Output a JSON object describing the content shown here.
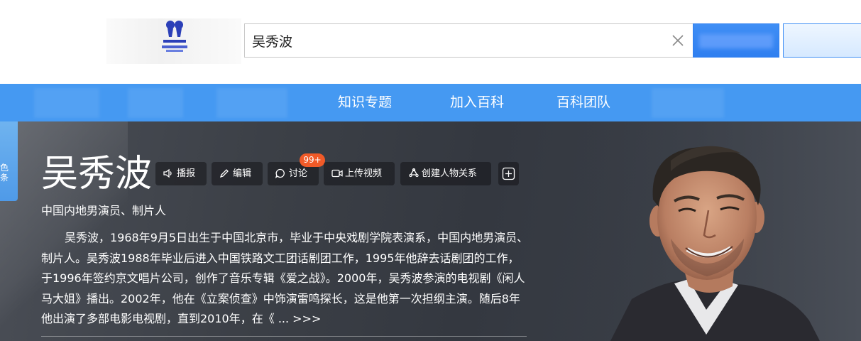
{
  "search": {
    "value": "吴秀波",
    "placeholder": ""
  },
  "nav": {
    "items": [
      "知识专题",
      "加入百科",
      "百科团队"
    ]
  },
  "side_tab": {
    "label": "色条"
  },
  "entry": {
    "title": "吴秀波",
    "subtitle": "中国内地男演员、制片人",
    "summary": "吴秀波，1968年9月5日出生于中国北京市，毕业于中央戏剧学院表演系，中国内地男演员、制片人。吴秀波1988年毕业后进入中国铁路文工团话剧团工作，1995年他辞去话剧团的工作，于1996年签约京文唱片公司，创作了音乐专辑《爱之战》。2000年，吴秀波参演的电视剧《闲人马大姐》播出。2002年，他在《立案侦查》中饰演雷鸣探长，这是他第一次担纲主演。随后8年他出演了多部电影电视剧，直到2010年，在《",
    "more_link": "... >>>"
  },
  "toolbar": {
    "broadcast_label": "播报",
    "edit_label": "编辑",
    "discuss_label": "讨论",
    "discuss_badge": "99+",
    "upload_video_label": "上传视频",
    "create_relation_label": "创建人物关系"
  },
  "colors": {
    "nav_bg": "#4599f2",
    "hero_bg": "#3c4047",
    "badge": "#f05a28",
    "search_button": "#2f7ff0"
  }
}
